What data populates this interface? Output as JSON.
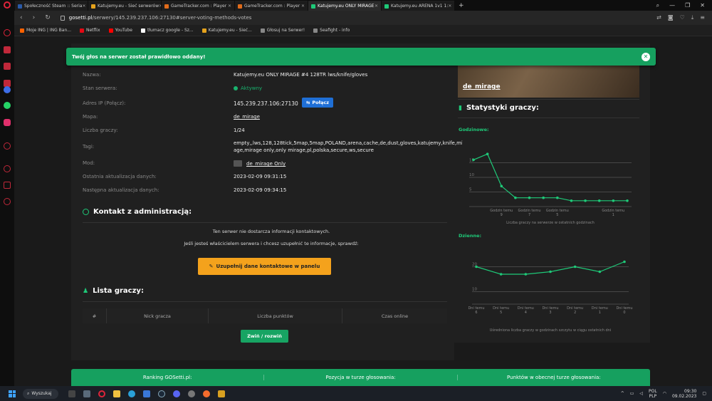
{
  "browser": {
    "tabs": [
      {
        "title": "Społeczność Steam :: Seria",
        "fav": "#2a5aa8",
        "active": false
      },
      {
        "title": "Katujemy.eu - Sieć serwerów",
        "fav": "#e5a21c",
        "active": false
      },
      {
        "title": "GameTracker.com : Player",
        "fav": "#e06b1a",
        "active": false
      },
      {
        "title": "GameTracker.com : Player",
        "fav": "#e06b1a",
        "active": false
      },
      {
        "title": "Katujemy.eu ONLY MIRAGE",
        "fav": "#1ec978",
        "active": true
      },
      {
        "title": "Katujemy.eu ARENA 1v1 1:",
        "fav": "#1ec978",
        "active": false
      }
    ],
    "url_host": "gosetti.pl",
    "url_path": "/serwery/145.239.237.106:27130#server-voting-methods-votes",
    "bookmarks": [
      {
        "label": "Moje ING | ING Ban...",
        "fav": "#ff6200"
      },
      {
        "label": "Netflix",
        "fav": "#e50914"
      },
      {
        "label": "YouTube",
        "fav": "#ff0000"
      },
      {
        "label": "tłumacz google - Sz...",
        "fav": "#ffffff"
      },
      {
        "label": "Katujemy.eu - Sieć...",
        "fav": "#e5a21c"
      },
      {
        "label": "Głosuj na Serwer!",
        "fav": "#888888"
      },
      {
        "label": "Seafight - info",
        "fav": "#888888"
      }
    ]
  },
  "toast": {
    "text": "Twój głos na serwer został prawidłowo oddany!",
    "close": "✕"
  },
  "server": {
    "rows": [
      {
        "label": "Nazwa:",
        "value": "Katujemy.eu ONLY MIRAGE #4 128TR lws/knife/gloves"
      },
      {
        "label": "Stan serwera:",
        "value": "Aktywny"
      },
      {
        "label": "Adres IP (Połącz):",
        "value": "145.239.237.106:27130"
      },
      {
        "label": "Mapa:",
        "value": "de_mirage"
      },
      {
        "label": "Liczba graczy:",
        "value": "1/24"
      },
      {
        "label": "Tagi:",
        "value": "empty,,lws,128,128tick,5map,5map,POLAND,arena,cache,de,dust,gloves,katujemy,knife,mir",
        "value2": "age,mirage only,only mirage,pl,polska,secure,ws,secure"
      },
      {
        "label": "Mod:",
        "value": "de_mirage Only"
      },
      {
        "label": "Ostatnia aktualizacja danych:",
        "value": "2023-02-09 09:31:15"
      },
      {
        "label": "Następna aktualizacja danych:",
        "value": "2023-02-09 09:34:15"
      }
    ],
    "connect_label": "Połącz"
  },
  "contact": {
    "title": "Kontakt z administracją:",
    "line1": "Ten serwer nie dostarcza informacji kontaktowych.",
    "line2": "Jeśli jesteś właścicielem serwera i chcesz uzupełnić te informacje, sprawdź:",
    "button": "Uzupełnij dane kontaktowe w panelu"
  },
  "players": {
    "title": "Lista graczy:",
    "columns": [
      "#",
      "Nick gracza",
      "Liczba punktów",
      "Czas online"
    ],
    "toggle_button": "Zwiń / rozwiń"
  },
  "ranking_bar": [
    "Ranking GOSetti.pl:",
    "Pozycja w turze głosowania:",
    "Punktów w obecnej turze głosowania:"
  ],
  "right": {
    "map_name": "de_mirage",
    "stats_title": "Statystyki graczy:",
    "hourly_label": "Godzinowe:",
    "hourly_caption": "Liczba graczy na serwerze w ostatnich godzinach",
    "daily_label": "Dzienne:",
    "daily_caption": "Uśredniona liczba graczy w godzinach szczytu w ciągu ostatnich dni"
  },
  "chart_data": [
    {
      "type": "line",
      "title": "Godzinowe:",
      "x": [
        "",
        "",
        "Godzin temu 9",
        "",
        "Godzin temu 7",
        "",
        "Godzin temu 5",
        "",
        "",
        "",
        "Godzin temu 1",
        ""
      ],
      "values": [
        16,
        18,
        7,
        3,
        3,
        3,
        3,
        2,
        2,
        2,
        2,
        2
      ],
      "ylim": [
        0,
        20
      ],
      "yticks": [
        5,
        10,
        15
      ],
      "color": "#1ec978"
    },
    {
      "type": "line",
      "title": "Dzienne:",
      "x": [
        "Dni temu 6",
        "Dni temu 5",
        "Dni temu 4",
        "Dni temu 3",
        "Dni temu 2",
        "Dni temu 1",
        "Dni temu 0"
      ],
      "values": [
        20,
        17,
        17,
        18,
        20,
        18,
        22
      ],
      "ylim": [
        5,
        25
      ],
      "yticks": [
        10,
        20
      ],
      "color": "#1ec978"
    }
  ],
  "taskbar": {
    "search": "Wyszukaj",
    "lang1": "POL",
    "lang2": "PLP",
    "time": "09:30",
    "date": "09.02.2023"
  }
}
